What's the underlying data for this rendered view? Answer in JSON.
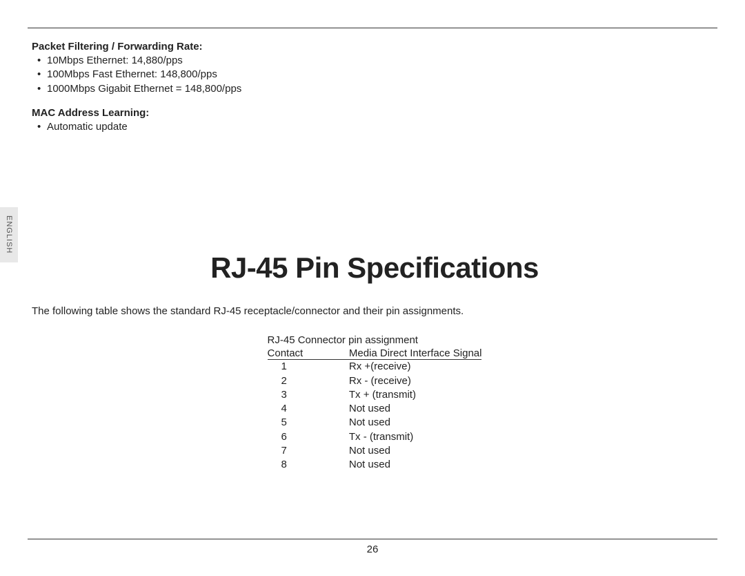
{
  "side_tab": "ENGLISH",
  "sections": {
    "packet": {
      "heading": "Packet Filtering / Forwarding Rate:",
      "items": [
        "10Mbps Ethernet: 14,880/pps",
        "100Mbps Fast Ethernet: 148,800/pps",
        "1000Mbps Gigabit Ethernet = 148,800/pps"
      ]
    },
    "mac": {
      "heading": "MAC Address Learning:",
      "items": [
        "Automatic update"
      ]
    }
  },
  "title": "RJ-45 Pin Specifications",
  "intro": "The following table shows the standard RJ-45 receptacle/connector and their pin assignments.",
  "table": {
    "caption": "RJ-45 Connector pin assignment",
    "headers": [
      "Contact",
      "Media Direct Interface Signal"
    ],
    "rows": [
      {
        "contact": "1",
        "signal": "Rx +(receive)"
      },
      {
        "contact": "2",
        "signal": "Rx - (receive)"
      },
      {
        "contact": "3",
        "signal": "Tx + (transmit)"
      },
      {
        "contact": "4",
        "signal": "Not used"
      },
      {
        "contact": "5",
        "signal": "Not used"
      },
      {
        "contact": "6",
        "signal": "Tx - (transmit)"
      },
      {
        "contact": "7",
        "signal": "Not used"
      },
      {
        "contact": "8",
        "signal": "Not used"
      }
    ]
  },
  "page_number": "26"
}
